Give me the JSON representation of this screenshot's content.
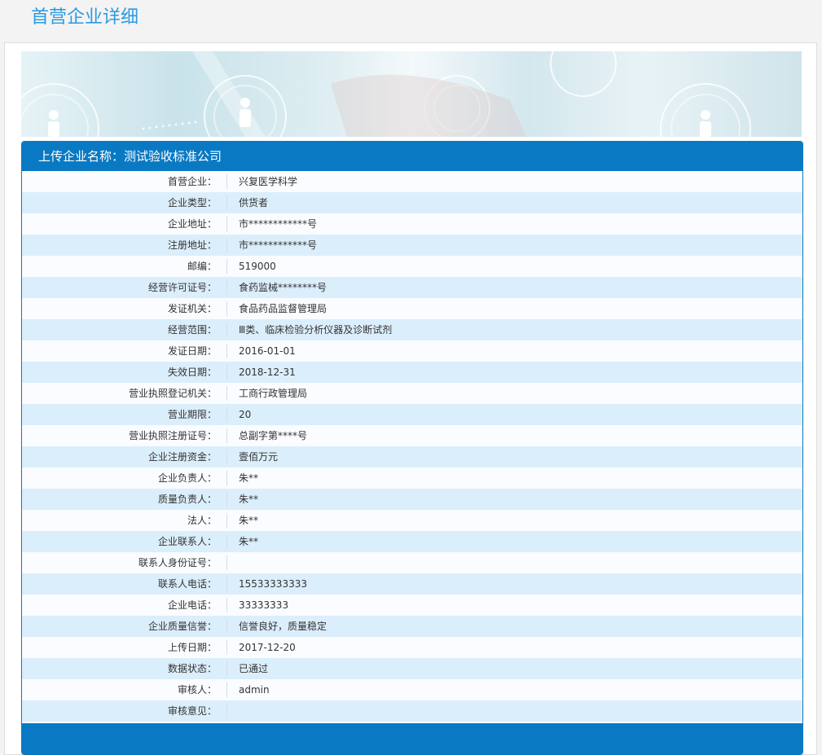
{
  "page": {
    "title": "首营企业详细"
  },
  "card": {
    "header": "上传企业名称：测试验收标准公司"
  },
  "fields": [
    {
      "label": "首营企业：",
      "value": "兴复医学科学"
    },
    {
      "label": "企业类型：",
      "value": "供货者"
    },
    {
      "label": "企业地址：",
      "value": "市************号"
    },
    {
      "label": "注册地址：",
      "value": "市************号"
    },
    {
      "label": "邮编：",
      "value": "519000"
    },
    {
      "label": "经营许可证号：",
      "value": "食药监械********号"
    },
    {
      "label": "发证机关：",
      "value": "食品药品监督管理局"
    },
    {
      "label": "经营范围：",
      "value": "Ⅲ类、临床检验分析仪器及诊断试剂"
    },
    {
      "label": "发证日期：",
      "value": "2016-01-01"
    },
    {
      "label": "失效日期：",
      "value": "2018-12-31"
    },
    {
      "label": "营业执照登记机关：",
      "value": "工商行政管理局"
    },
    {
      "label": "营业期限：",
      "value": "20"
    },
    {
      "label": "营业执照注册证号：",
      "value": "总副字第****号"
    },
    {
      "label": "企业注册资金：",
      "value": "壹佰万元"
    },
    {
      "label": "企业负责人：",
      "value": "朱**"
    },
    {
      "label": "质量负责人：",
      "value": "朱**"
    },
    {
      "label": "法人：",
      "value": "朱**"
    },
    {
      "label": "企业联系人：",
      "value": "朱**"
    },
    {
      "label": "联系人身份证号：",
      "value": ""
    },
    {
      "label": "联系人电话：",
      "value": "15533333333"
    },
    {
      "label": "企业电话：",
      "value": "33333333"
    },
    {
      "label": "企业质量信誉：",
      "value": "信誉良好，质量稳定"
    },
    {
      "label": "上传日期：",
      "value": "2017-12-20"
    },
    {
      "label": "数据状态：",
      "value": "已通过"
    },
    {
      "label": "审核人：",
      "value": "admin"
    },
    {
      "label": "审核意见：",
      "value": ""
    }
  ],
  "colors": {
    "accent": "#0a79c3",
    "title": "#2a9be0",
    "row_alt": "#dbeefb"
  }
}
